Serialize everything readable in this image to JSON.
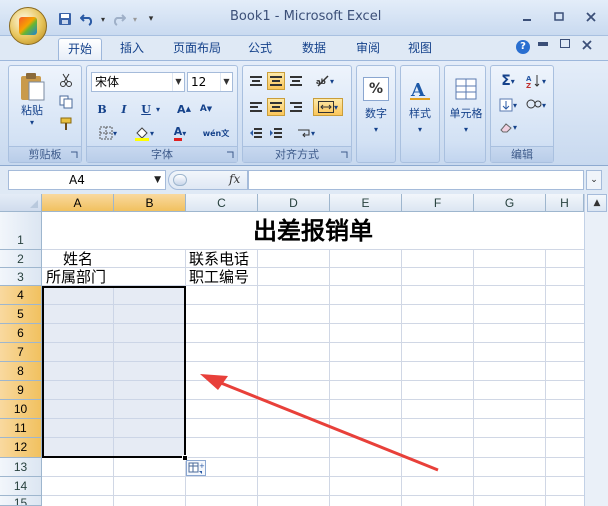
{
  "window": {
    "title": "Book1 - Microsoft Excel"
  },
  "tabs": [
    "开始",
    "插入",
    "页面布局",
    "公式",
    "数据",
    "审阅",
    "视图"
  ],
  "ribbon": {
    "clipboard": {
      "paste": "粘贴",
      "label": "剪贴板"
    },
    "font": {
      "name": "宋体",
      "size": "12",
      "label": "字体"
    },
    "alignment": {
      "label": "对齐方式"
    },
    "number": {
      "label": "数字",
      "symbol": "%"
    },
    "styles": {
      "label": "样式"
    },
    "cells": {
      "label": "单元格"
    },
    "editing": {
      "label": "编辑"
    }
  },
  "formula_bar": {
    "name_box": "A4",
    "fx": "fx",
    "content": ""
  },
  "columns": [
    "A",
    "B",
    "C",
    "D",
    "E",
    "F",
    "G",
    "H"
  ],
  "rows": [
    "1",
    "2",
    "3",
    "4",
    "5",
    "6",
    "7",
    "8",
    "9",
    "10",
    "11",
    "12",
    "13",
    "14",
    "15"
  ],
  "cells": {
    "title": "出差报销单",
    "a2": "姓名",
    "c2": "联系电话",
    "a3": "所属部门",
    "c3": "职工编号"
  },
  "colors": {
    "selection_border": "#000000",
    "arrow": "#e8403a",
    "header_selected": "#f1c15f"
  }
}
